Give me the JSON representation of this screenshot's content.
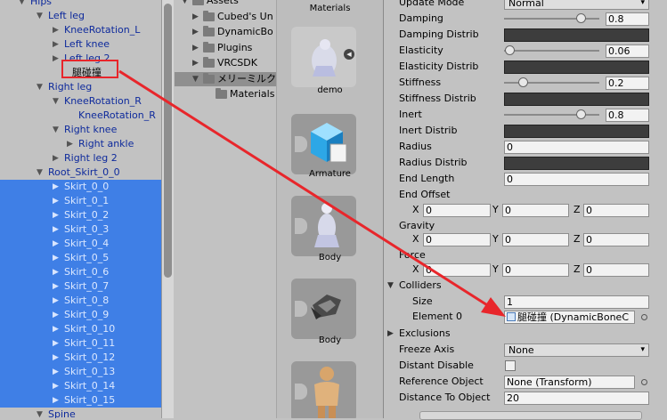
{
  "hierarchy": {
    "rows": [
      {
        "label": "Hips",
        "arrow": "▼",
        "plain": false,
        "sel": false
      },
      {
        "label": "Left leg",
        "arrow": "▼",
        "plain": false,
        "sel": false
      },
      {
        "label": "KneeRotation_L",
        "arrow": "▶",
        "plain": false,
        "sel": false
      },
      {
        "label": "Left knee",
        "arrow": "▶",
        "plain": false,
        "sel": false
      },
      {
        "label": "Left leg 2",
        "arrow": "▶",
        "plain": false,
        "sel": false
      },
      {
        "label": "腿碰撞",
        "arrow": "",
        "plain": true,
        "sel": false
      },
      {
        "label": "Right leg",
        "arrow": "▼",
        "plain": false,
        "sel": false
      },
      {
        "label": "KneeRotation_R",
        "arrow": "▼",
        "plain": false,
        "sel": false
      },
      {
        "label": "KneeRotation_R",
        "arrow": "",
        "plain": false,
        "sel": false
      },
      {
        "label": "Right knee",
        "arrow": "▼",
        "plain": false,
        "sel": false
      },
      {
        "label": "Right ankle",
        "arrow": "▶",
        "plain": false,
        "sel": false
      },
      {
        "label": "Right leg 2",
        "arrow": "▶",
        "plain": false,
        "sel": false
      },
      {
        "label": "Root_Skirt_0_0",
        "arrow": "▼",
        "plain": false,
        "sel": false
      },
      {
        "label": "Skirt_0_0",
        "arrow": "▶",
        "plain": false,
        "sel": true
      },
      {
        "label": "Skirt_0_1",
        "arrow": "▶",
        "plain": false,
        "sel": true
      },
      {
        "label": "Skirt_0_2",
        "arrow": "▶",
        "plain": false,
        "sel": true
      },
      {
        "label": "Skirt_0_3",
        "arrow": "▶",
        "plain": false,
        "sel": true
      },
      {
        "label": "Skirt_0_4",
        "arrow": "▶",
        "plain": false,
        "sel": true
      },
      {
        "label": "Skirt_0_5",
        "arrow": "▶",
        "plain": false,
        "sel": true
      },
      {
        "label": "Skirt_0_6",
        "arrow": "▶",
        "plain": false,
        "sel": true
      },
      {
        "label": "Skirt_0_7",
        "arrow": "▶",
        "plain": false,
        "sel": true
      },
      {
        "label": "Skirt_0_8",
        "arrow": "▶",
        "plain": false,
        "sel": true
      },
      {
        "label": "Skirt_0_9",
        "arrow": "▶",
        "plain": false,
        "sel": true
      },
      {
        "label": "Skirt_0_10",
        "arrow": "▶",
        "plain": false,
        "sel": true
      },
      {
        "label": "Skirt_0_11",
        "arrow": "▶",
        "plain": false,
        "sel": true
      },
      {
        "label": "Skirt_0_12",
        "arrow": "▶",
        "plain": false,
        "sel": true
      },
      {
        "label": "Skirt_0_13",
        "arrow": "▶",
        "plain": false,
        "sel": true
      },
      {
        "label": "Skirt_0_14",
        "arrow": "▶",
        "plain": false,
        "sel": true
      },
      {
        "label": "Skirt_0_15",
        "arrow": "▶",
        "plain": false,
        "sel": true
      },
      {
        "label": "Spine",
        "arrow": "▼",
        "plain": false,
        "sel": false
      }
    ]
  },
  "project": {
    "rows": [
      {
        "label": "Assets",
        "arrow": "▼",
        "hl": false
      },
      {
        "label": "Cubed's Un",
        "arrow": "▶",
        "hl": false
      },
      {
        "label": "DynamicBo",
        "arrow": "▶",
        "hl": false
      },
      {
        "label": "Plugins",
        "arrow": "▶",
        "hl": false
      },
      {
        "label": "VRCSDK",
        "arrow": "▶",
        "hl": false
      },
      {
        "label": "メリーミルク",
        "arrow": "▼",
        "hl": true
      },
      {
        "label": "Materials",
        "arrow": "",
        "hl": false
      }
    ]
  },
  "assets": {
    "items": [
      {
        "label": "Materials",
        "icon": "folder-icon"
      },
      {
        "label": "demo",
        "icon": "prefab-figure-icon"
      },
      {
        "label": "Armature",
        "icon": "cube-icon"
      },
      {
        "label": "Body",
        "icon": "figure-icon"
      },
      {
        "label": "Body",
        "icon": "mesh-icon"
      },
      {
        "label": "",
        "icon": "avatar-icon"
      }
    ]
  },
  "inspector": {
    "update_mode": {
      "label": "Update Mode",
      "value": "Normal"
    },
    "damping": {
      "label": "Damping",
      "value": "0.8",
      "level": 0.8
    },
    "damping_distrib": {
      "label": "Damping Distrib"
    },
    "elasticity": {
      "label": "Elasticity",
      "value": "0.06",
      "level": 0.06
    },
    "elasticity_distrib": {
      "label": "Elasticity Distrib"
    },
    "stiffness": {
      "label": "Stiffness",
      "value": "0.2",
      "level": 0.2
    },
    "stiffness_distrib": {
      "label": "Stiffness Distrib"
    },
    "inert": {
      "label": "Inert",
      "value": "0.8",
      "level": 0.8
    },
    "inert_distrib": {
      "label": "Inert Distrib"
    },
    "radius": {
      "label": "Radius",
      "value": "0"
    },
    "radius_distrib": {
      "label": "Radius Distrib"
    },
    "end_length": {
      "label": "End Length",
      "value": "0"
    },
    "end_offset": {
      "label": "End Offset",
      "x": "0",
      "y": "0",
      "z": "0"
    },
    "gravity": {
      "label": "Gravity",
      "x": "0",
      "y": "0",
      "z": "0"
    },
    "force": {
      "label": "Force",
      "x": "0",
      "y": "0",
      "z": "0"
    },
    "axis_labels": {
      "x": "X",
      "y": "Y",
      "z": "Z"
    },
    "colliders": {
      "label": "Colliders",
      "size_label": "Size",
      "size": "1",
      "element_label": "Element 0",
      "element_value": "腿碰撞 (DynamicBoneC"
    },
    "exclusions": {
      "label": "Exclusions"
    },
    "freeze_axis": {
      "label": "Freeze Axis",
      "value": "None"
    },
    "distant_disable": {
      "label": "Distant Disable"
    },
    "reference_object": {
      "label": "Reference Object",
      "value": "None (Transform)"
    },
    "distance_to_object": {
      "label": "Distance To Object",
      "value": "20"
    }
  },
  "colors": {
    "selection": "#3f7fe6",
    "annotation": "#e8262b",
    "curve": "#3d3d3d"
  }
}
